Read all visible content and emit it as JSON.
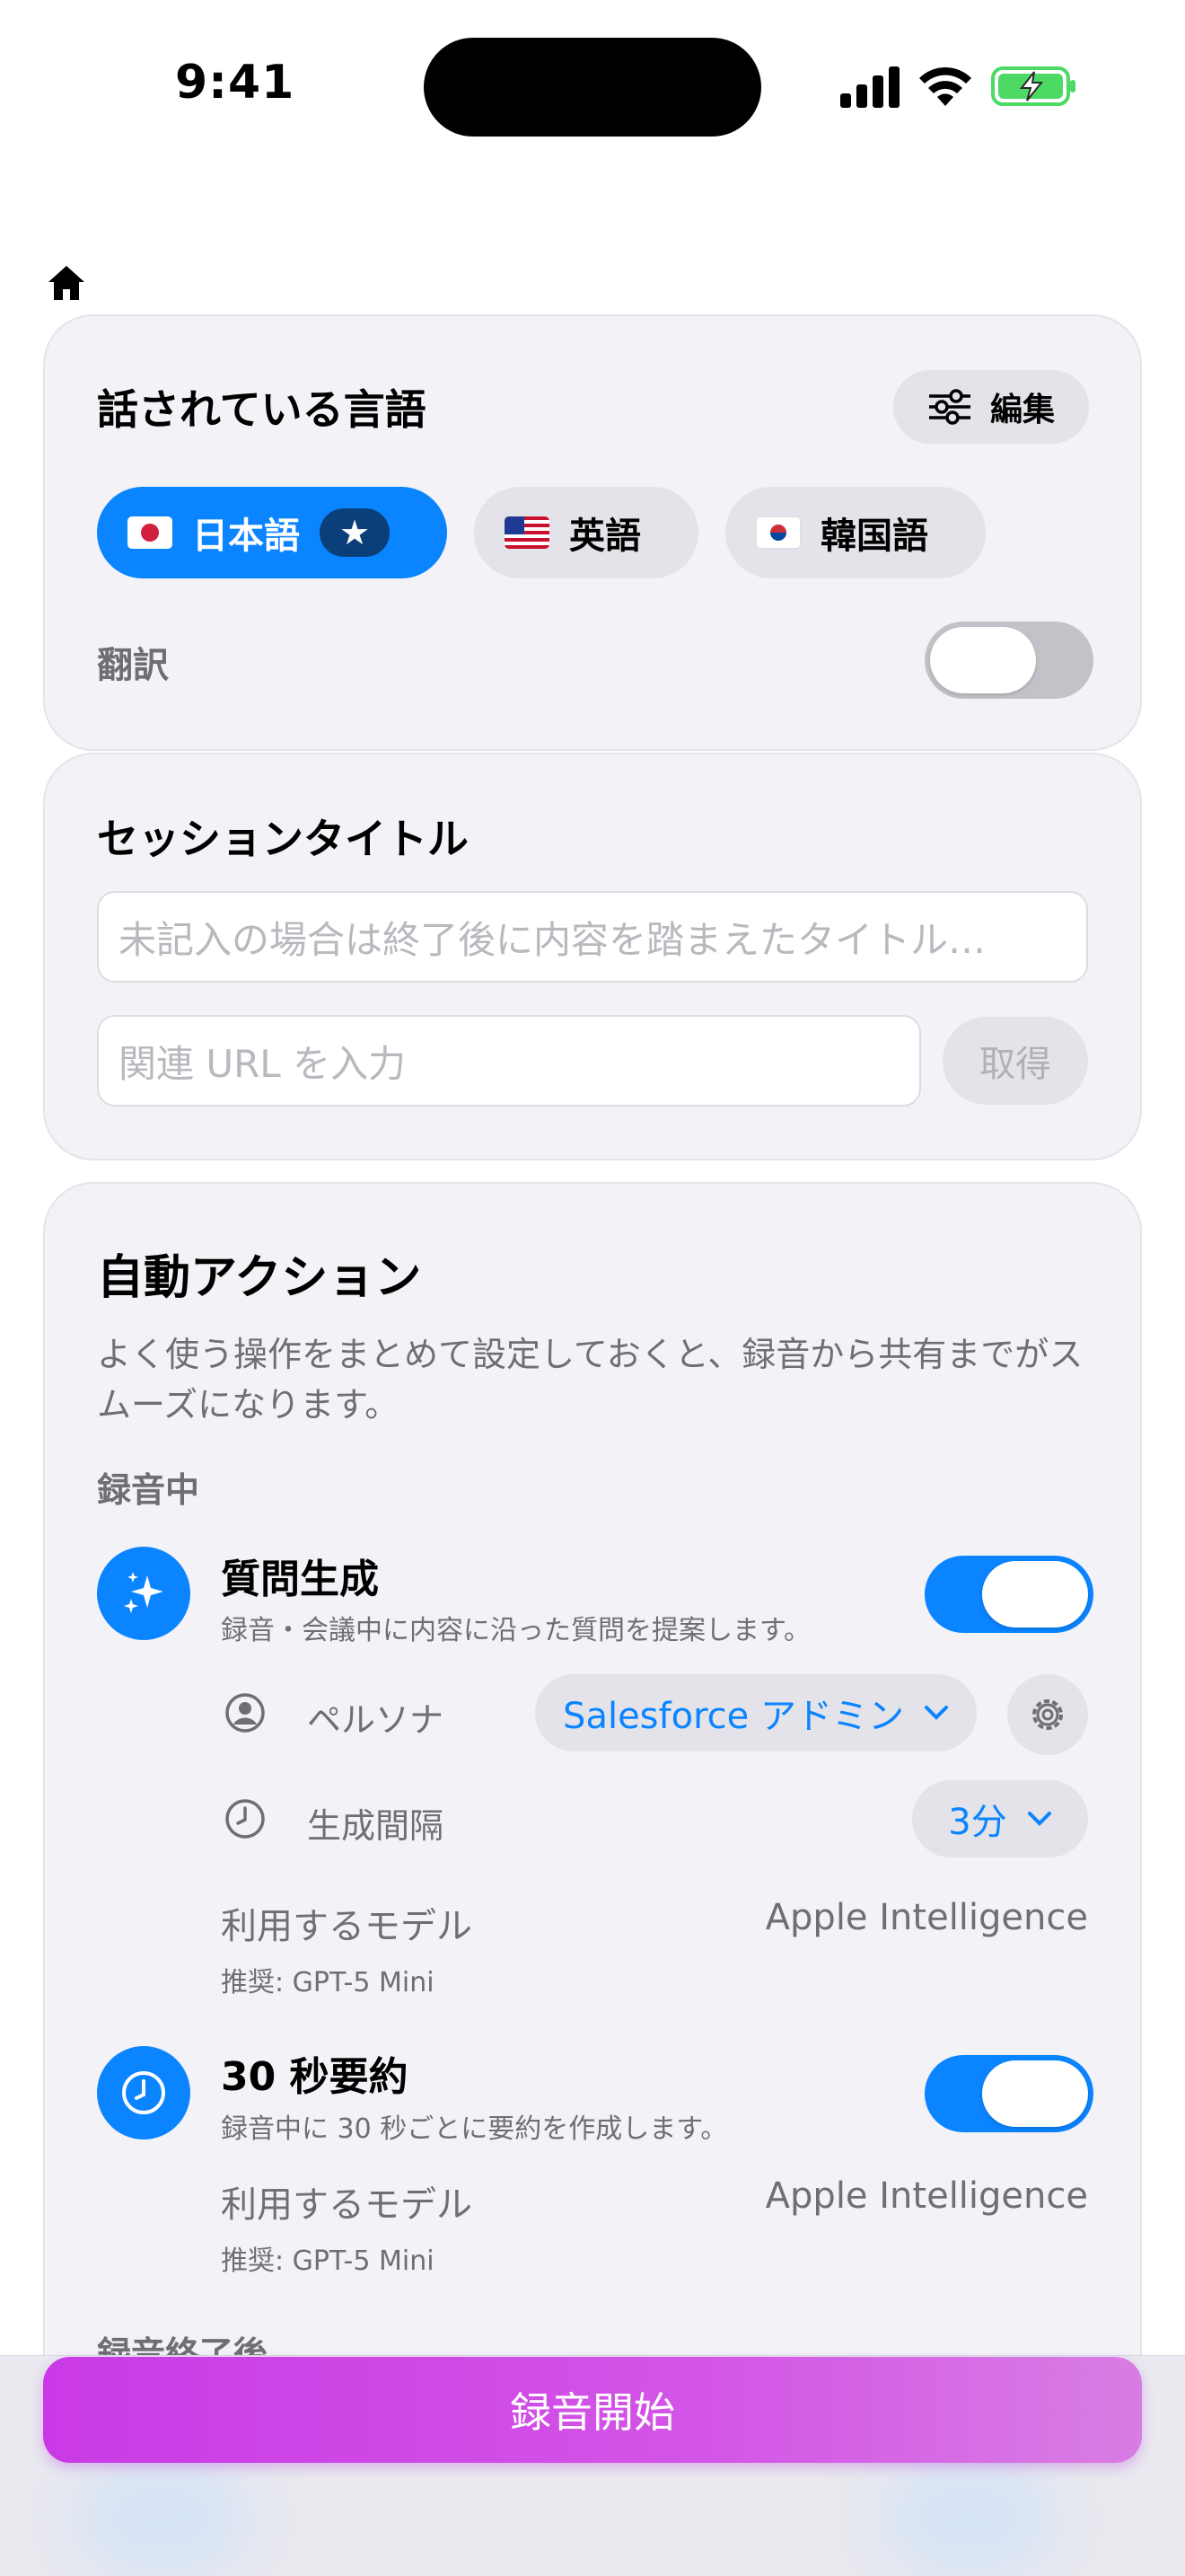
{
  "status_bar": {
    "time": "9:41"
  },
  "languages": {
    "title": "話されている言語",
    "edit_label": "編集",
    "chips": [
      {
        "label": "日本語",
        "selected": true,
        "starred": true
      },
      {
        "label": "英語",
        "selected": false
      },
      {
        "label": "韓国語",
        "selected": false
      }
    ],
    "translate_label": "翻訳",
    "translate_on": false
  },
  "session": {
    "title": "セッションタイトル",
    "title_placeholder": "未記入の場合は終了後に内容を踏まえたタイトル…",
    "url_placeholder": "関連 URL を入力",
    "fetch_label": "取得"
  },
  "auto_actions": {
    "title": "自動アクション",
    "description": "よく使う操作をまとめて設定しておくと、録音から共有までがスムーズになります。",
    "section_recording": "録音中",
    "question": {
      "title": "質問生成",
      "subtitle": "録音・会議中に内容に沿った質問を提案します。",
      "enabled": true,
      "persona_label": "ペルソナ",
      "persona_value": "Salesforce アドミン",
      "interval_label": "生成間隔",
      "interval_value": "3分",
      "model_label": "利用するモデル",
      "model_value": "Apple Intelligence",
      "recommended": "推奨: GPT-5 Mini"
    },
    "summary": {
      "title": "30 秒要約",
      "subtitle": "録音中に 30 秒ごとに要約を作成します。",
      "enabled": true,
      "model_label": "利用するモデル",
      "model_value": "Apple Intelligence",
      "recommended": "推奨: GPT-5 Mini"
    },
    "section_after": "録音終了後"
  },
  "record_button": "録音開始",
  "colors": {
    "accent": "#0a84ff",
    "record_gradient_start": "#c93ae6",
    "record_gradient_end": "#d87de3"
  }
}
